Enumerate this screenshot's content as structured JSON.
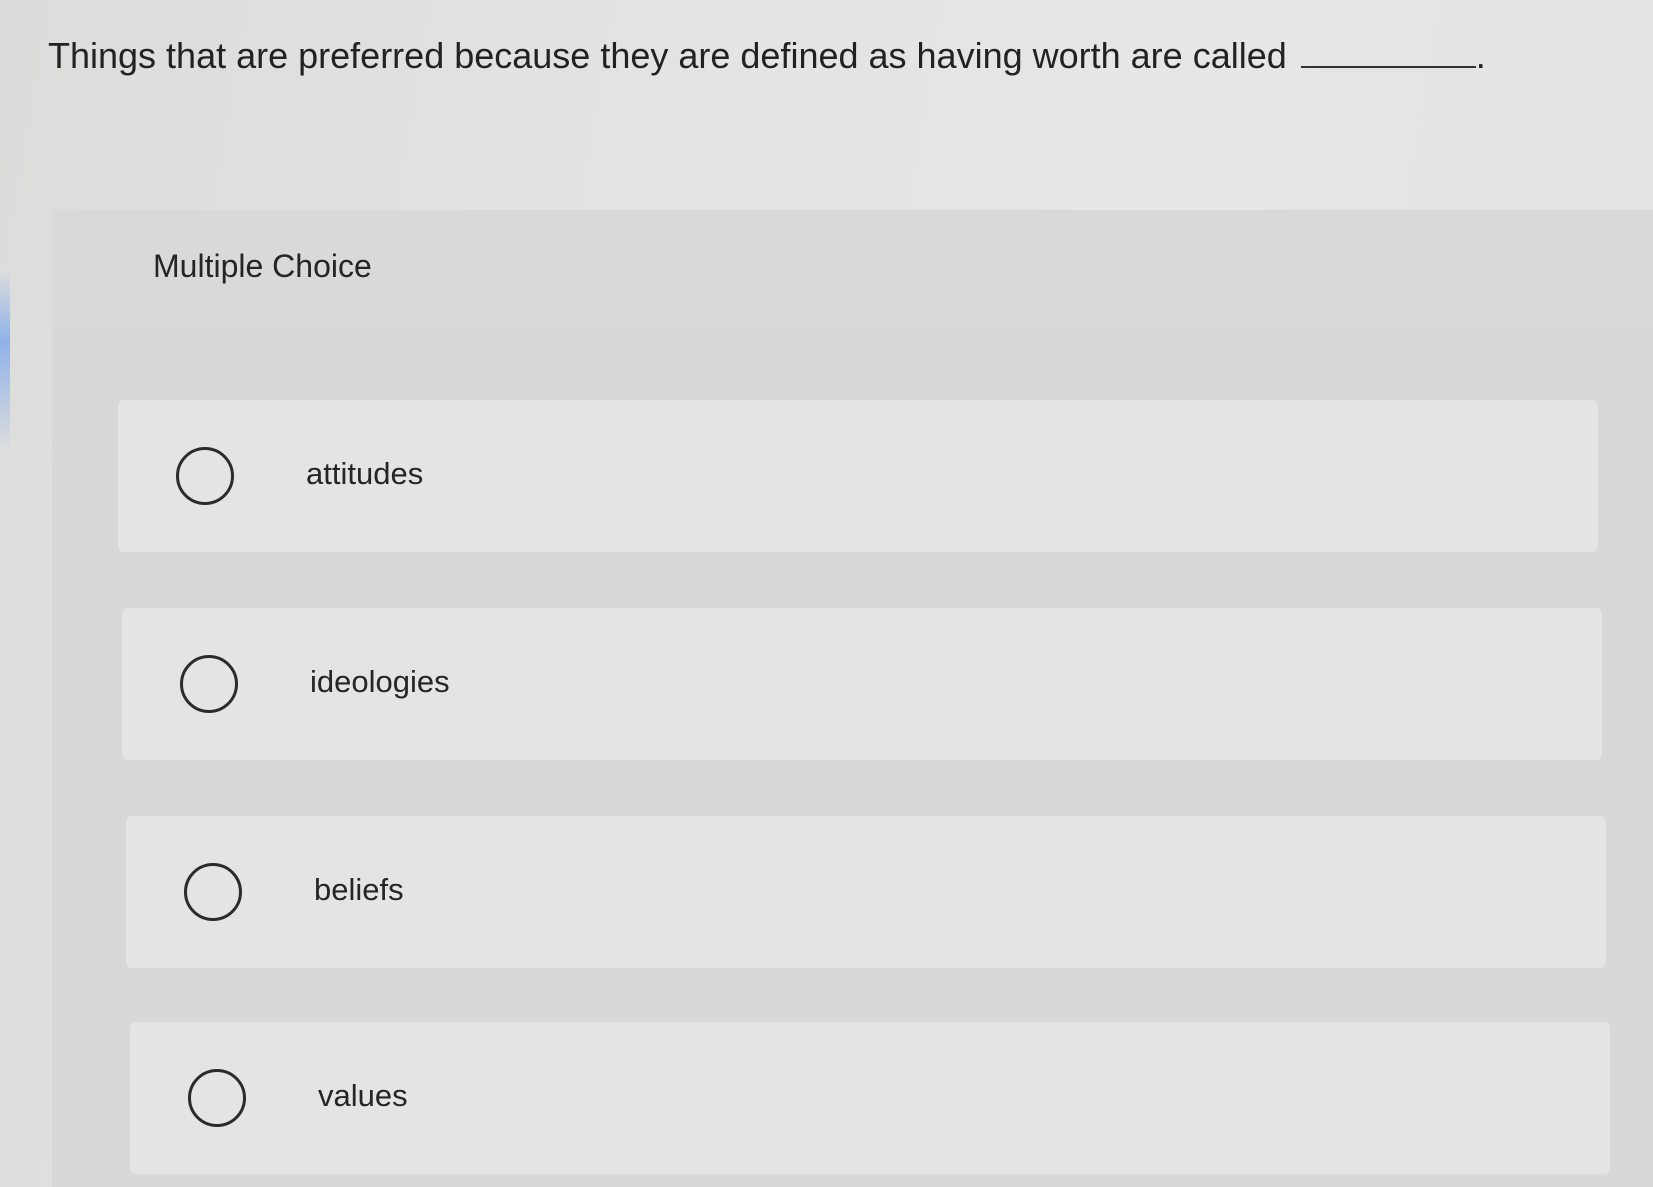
{
  "question": {
    "text": "Things that are preferred because they are defined as having worth are called",
    "trailing_punctuation": "."
  },
  "multiple_choice": {
    "label": "Multiple Choice",
    "options": [
      {
        "label": "attitudes",
        "selected": false
      },
      {
        "label": "ideologies",
        "selected": false
      },
      {
        "label": "beliefs",
        "selected": false
      },
      {
        "label": "values",
        "selected": false
      }
    ]
  }
}
